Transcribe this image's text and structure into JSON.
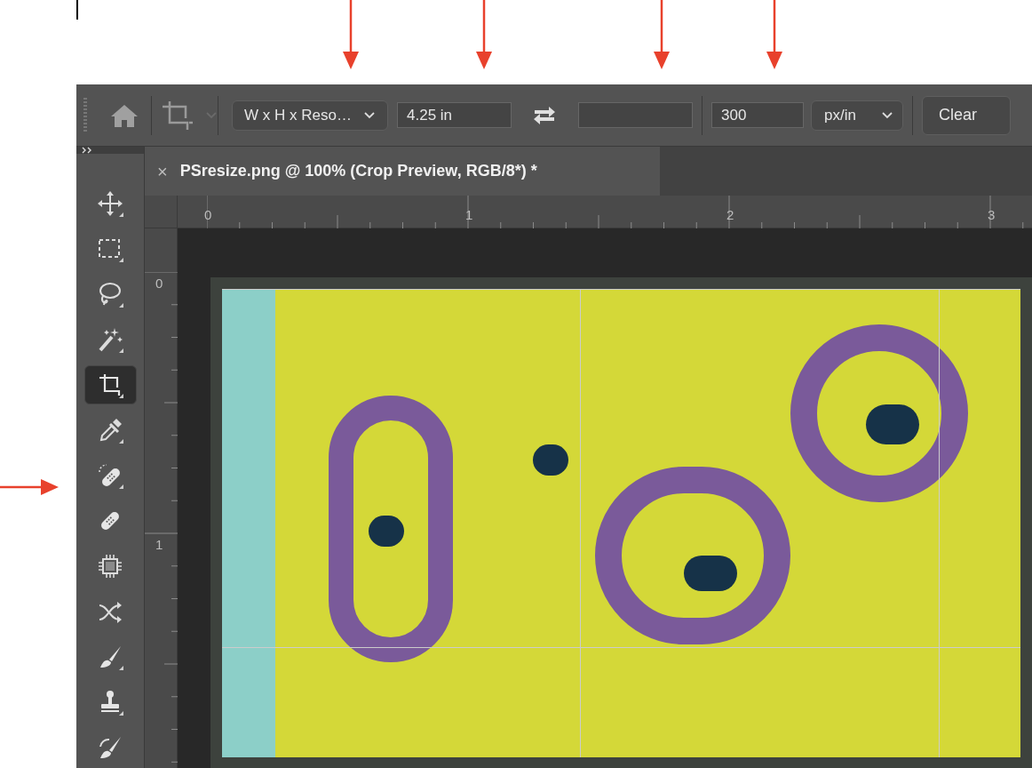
{
  "options_bar": {
    "ratio_preset": "W x H x Reso…",
    "width": "4.25 in",
    "resolution": "300",
    "resolution_unit": "px/in",
    "clear_button": "Clear"
  },
  "document_tab": {
    "close": "×",
    "title": "PSresize.png @ 100% (Crop Preview, RGB/8*) *"
  },
  "rulers": {
    "horizontal": [
      "0",
      "1",
      "2",
      "3"
    ],
    "vertical": [
      "0",
      "1"
    ]
  },
  "tools": [
    {
      "kind": "move",
      "selected": false
    },
    {
      "kind": "marquee",
      "selected": false
    },
    {
      "kind": "lasso",
      "selected": false
    },
    {
      "kind": "wand",
      "selected": false
    },
    {
      "kind": "crop",
      "selected": true
    },
    {
      "kind": "eyedropper",
      "selected": false
    },
    {
      "kind": "spot_healing",
      "selected": false
    },
    {
      "kind": "healing",
      "selected": false
    },
    {
      "kind": "patch",
      "selected": false
    },
    {
      "kind": "content_move",
      "selected": false
    },
    {
      "kind": "brush",
      "selected": false
    },
    {
      "kind": "stamp",
      "selected": false
    },
    {
      "kind": "history_brush",
      "selected": false
    }
  ]
}
